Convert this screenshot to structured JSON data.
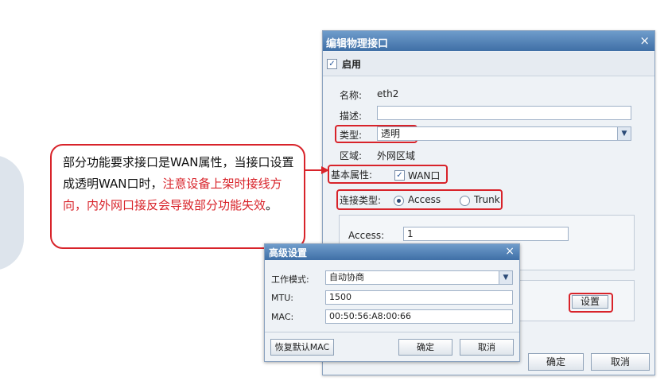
{
  "main_dialog": {
    "title": "编辑物理接口",
    "close_glyph": "×",
    "enable_label": "启用",
    "enable_checked": true,
    "name_label": "名称:",
    "name_value": "eth2",
    "desc_label": "描述:",
    "desc_value": "",
    "type_label": "类型:",
    "type_value": "透明",
    "zone_label": "区域:",
    "zone_value": "外网区域",
    "basic_attr_label": "基本属性:",
    "wan_label": "WAN口",
    "wan_checked": true,
    "conn_type_label": "连接类型:",
    "conn_options": [
      "Access",
      "Trunk"
    ],
    "conn_selected": "Access",
    "access_label": "Access:",
    "access_value": "1",
    "settings_button": "设置",
    "ok_button": "确定",
    "cancel_button": "取消"
  },
  "callout": {
    "text_normal": "部分功能要求接口是WAN属性，当接口设置成透明WAN口时，",
    "text_red": "注意设备上架时接线方向，内外网口接反会导致部分功能失效",
    "text_end": "。"
  },
  "advanced_dialog": {
    "title": "高级设置",
    "close_glyph": "×",
    "mode_label": "工作模式:",
    "mode_value": "自动协商",
    "mtu_label": "MTU:",
    "mtu_value": "1500",
    "mac_label": "MAC:",
    "mac_value": "00:50:56:A8:00:66",
    "restore_button": "恢复默认MAC",
    "ok_button": "确定",
    "cancel_button": "取消"
  },
  "colors": {
    "accent_red": "#d8232a",
    "title_bar": "#3f6fa6"
  }
}
